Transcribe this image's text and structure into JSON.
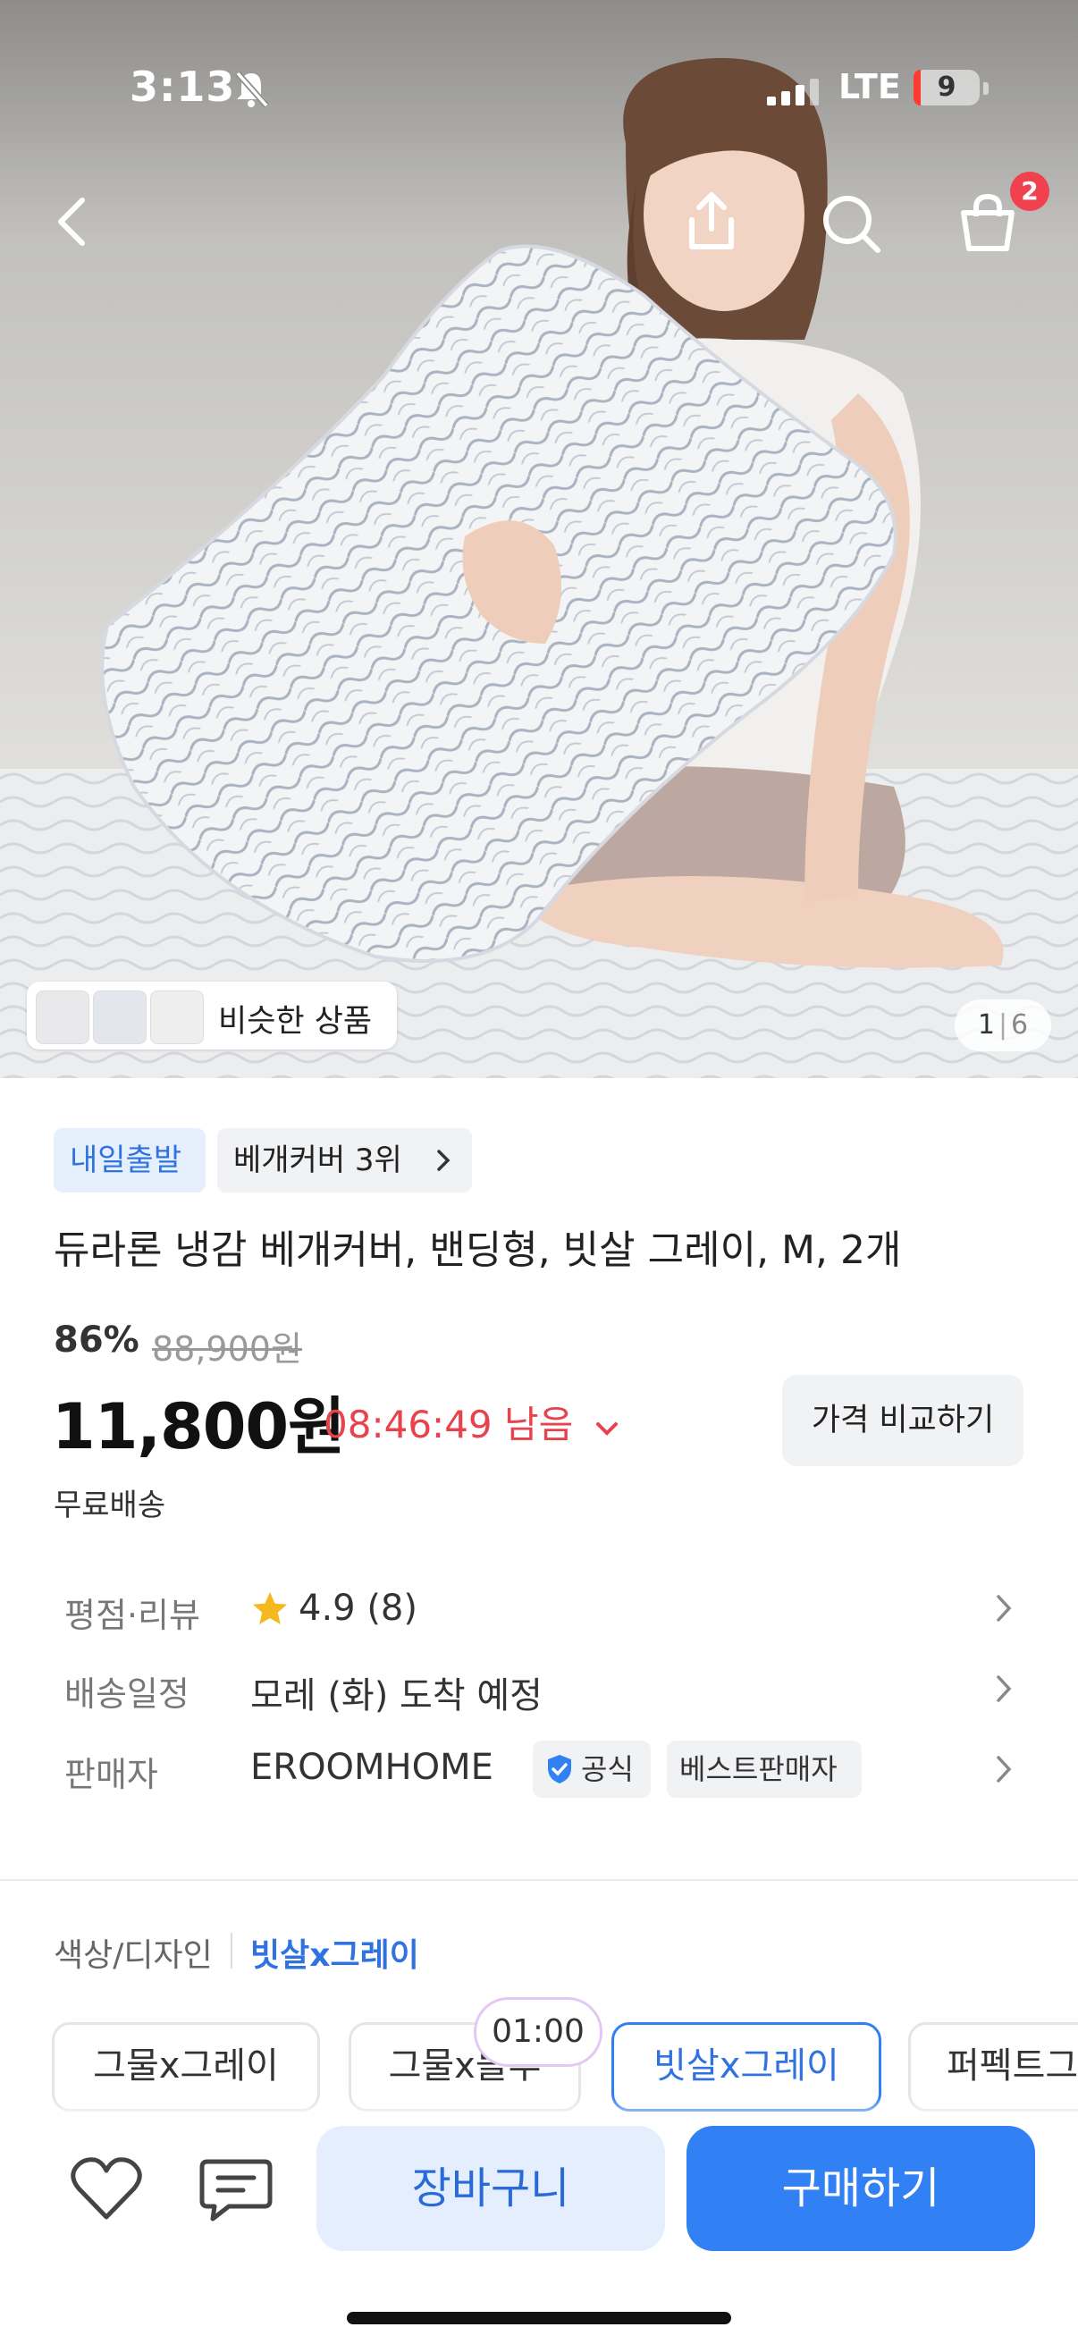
{
  "status_bar": {
    "time": "3:13",
    "network": "LTE",
    "battery": "9"
  },
  "top_nav": {
    "cart_count": "2"
  },
  "gallery": {
    "similar_label": "비슷한 상품",
    "current_page": "1",
    "total_pages": "6"
  },
  "product": {
    "badge_delivery": "내일출발",
    "badge_rank": "베개커버 3위",
    "title": "듀라론 냉감 베개커버, 밴딩형, 빗살 그레이, M, 2개",
    "discount": "86%",
    "original_price": "88,900원",
    "price": "11,800원",
    "timer": "08:46:49 남음",
    "compare_label": "가격 비교하기",
    "shipping": "무료배송"
  },
  "info_rows": {
    "rating_label": "평점·리뷰",
    "rating_value": "4.9 (8)",
    "delivery_label": "배송일정",
    "delivery_value": "모레 (화) 도착 예정",
    "seller_label": "판매자",
    "seller_value": "EROOMHOME",
    "official_badge": "공식",
    "best_seller_badge": "베스트판매자"
  },
  "options": {
    "label": "색상/디자인",
    "selected": "빗살x그레이",
    "chips": [
      "그물x그레이",
      "그물x블루",
      "빗살x그레이",
      "퍼펙트그레이"
    ],
    "timer_overlay": "01:00"
  },
  "bottom_bar": {
    "cart_label": "장바구니",
    "buy_label": "구매하기"
  },
  "colors": {
    "accent": "#3181f5",
    "timer_red": "#e8424d",
    "badge_red": "#f0414e"
  }
}
